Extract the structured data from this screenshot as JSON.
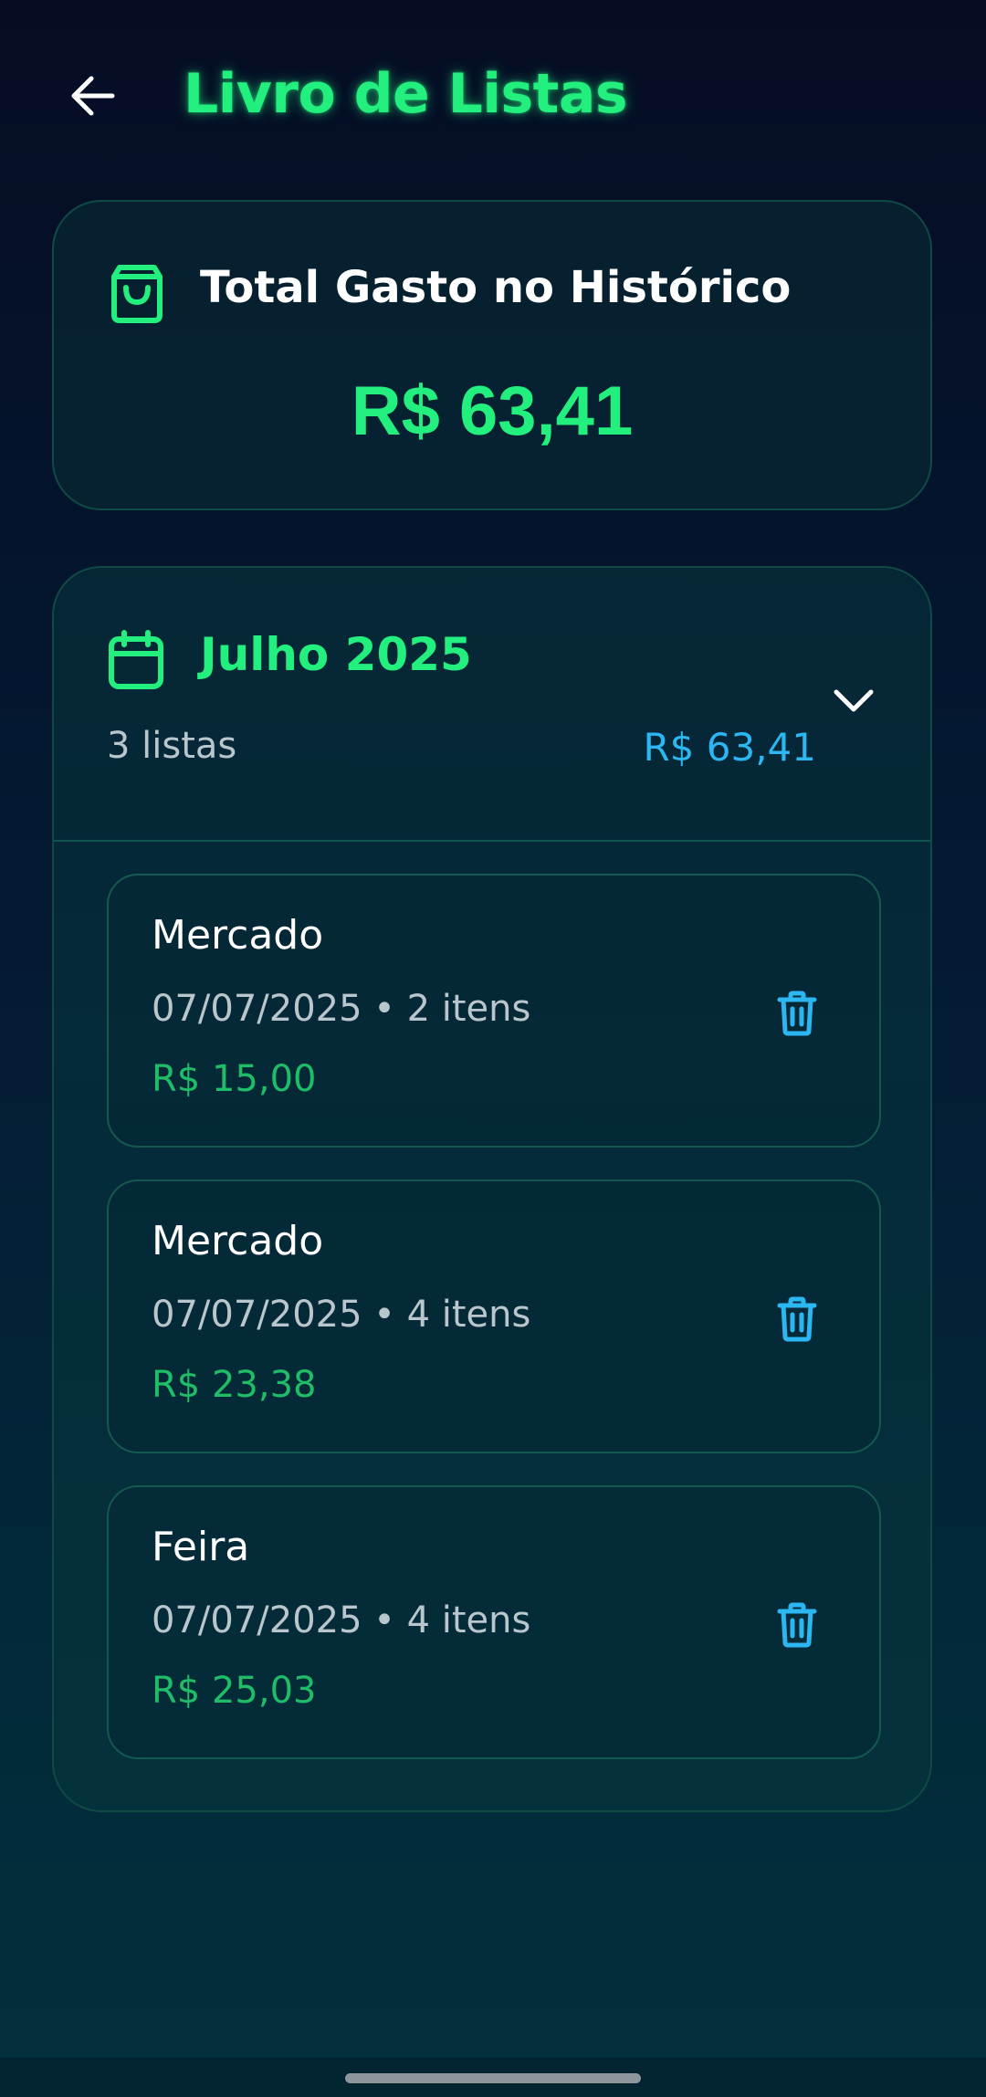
{
  "header": {
    "title": "Livro de Listas",
    "back_icon": "arrow-left-icon"
  },
  "summary": {
    "icon": "shopping-bag-icon",
    "label": "Total Gasto no Histórico",
    "amount": "R$ 63,41"
  },
  "month": {
    "icon": "calendar-icon",
    "name": "Julho 2025",
    "count": "3 listas",
    "total": "R$ 63,41",
    "expand_icon": "chevron-down-icon",
    "lists": [
      {
        "name": "Mercado",
        "meta": "07/07/2025 • 2 itens",
        "price": "R$ 15,00"
      },
      {
        "name": "Mercado",
        "meta": "07/07/2025 • 4 itens",
        "price": "R$ 23,38"
      },
      {
        "name": "Feira",
        "meta": "07/07/2025 • 4 itens",
        "price": "R$ 25,03"
      }
    ]
  },
  "colors": {
    "accent_green": "#22ef7d",
    "price_green": "#1fbd68",
    "accent_blue": "#2cb6f2"
  }
}
